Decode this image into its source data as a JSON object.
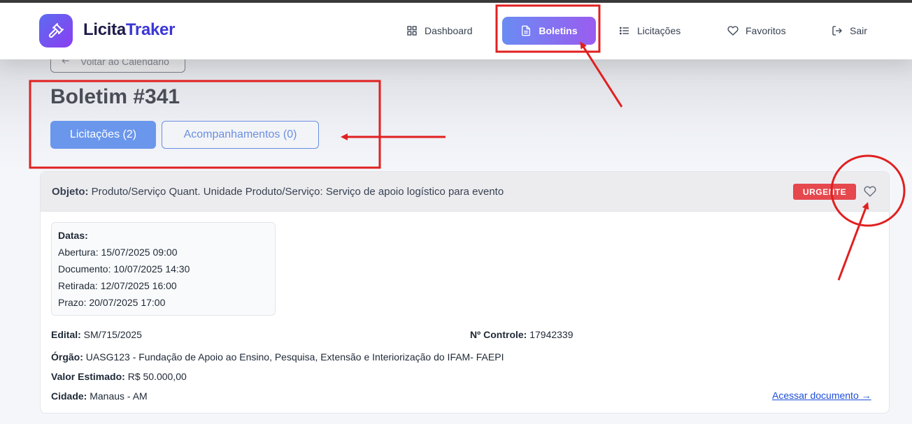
{
  "app": {
    "name_part1": "Licita",
    "name_part2": "Traker"
  },
  "nav": {
    "dashboard": "Dashboard",
    "boletins": "Boletins",
    "licitacoes": "Licitações",
    "favoritos": "Favoritos",
    "sair": "Sair"
  },
  "back_button": "Voltar ao Calendário",
  "page_title": "Boletim #341",
  "tabs": {
    "licitacoes": "Licitações (2)",
    "acompanhamentos": "Acompanhamentos (0)"
  },
  "card": {
    "objeto_label": "Objeto:",
    "objeto_value": "Produto/Serviço Quant. Unidade Produto/Serviço: Serviço de apoio logístico para evento",
    "badge": "URGENTE",
    "datas": {
      "header": "Datas:",
      "abertura_label": "Abertura:",
      "abertura": "15/07/2025 09:00",
      "documento_label": "Documento:",
      "documento": "10/07/2025 14:30",
      "retirada_label": "Retirada:",
      "retirada": "12/07/2025 16:00",
      "prazo_label": "Prazo:",
      "prazo": "20/07/2025 17:00"
    },
    "edital_label": "Edital:",
    "edital": "SM/715/2025",
    "controle_label": "Nº Controle:",
    "controle": "17942339",
    "orgao_label": "Órgão:",
    "orgao": "UASG123 - Fundação de Apoio ao Ensino, Pesquisa, Extensão e Interiorização do IFAM- FAEPI",
    "valor_label": "Valor Estimado:",
    "valor": "R$ 50.000,00",
    "cidade_label": "Cidade:",
    "cidade": "Manaus - AM",
    "link": "Acessar documento →"
  },
  "colors": {
    "accent_gradient_start": "#6a8cf2",
    "accent_gradient_end": "#9a5cf0",
    "urgent": "#e5484d",
    "annotation": "#e02020"
  }
}
